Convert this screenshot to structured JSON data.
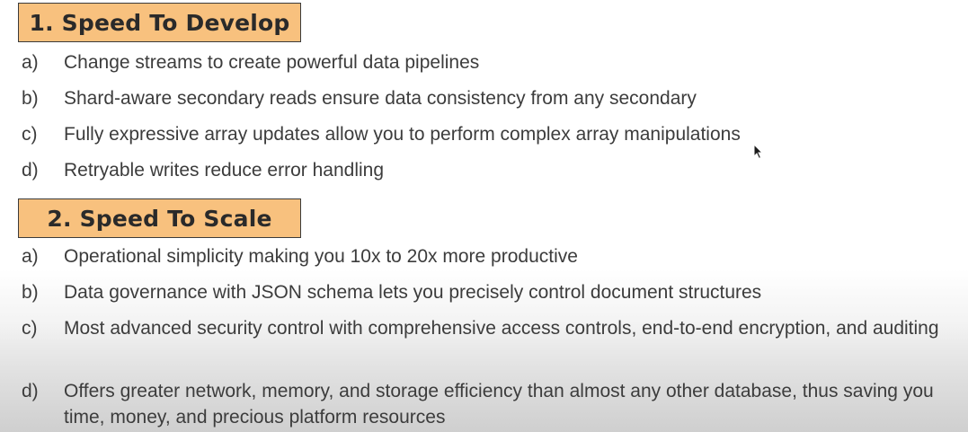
{
  "sections": [
    {
      "heading": "1. Speed To Develop",
      "items": [
        {
          "marker": "a)",
          "text": "Change streams to create powerful data pipelines"
        },
        {
          "marker": "b)",
          "text": "Shard-aware secondary reads ensure data consistency from any secondary"
        },
        {
          "marker": "c)",
          "text": "Fully expressive array updates allow you to perform complex array manipulations"
        },
        {
          "marker": "d)",
          "text": "Retryable writes reduce error handling"
        }
      ]
    },
    {
      "heading": "2. Speed To Scale",
      "items": [
        {
          "marker": "a)",
          "text": "Operational simplicity making you 10x to 20x more productive"
        },
        {
          "marker": "b)",
          "text": "Data governance with JSON schema lets you precisely control document structures"
        },
        {
          "marker": "c)",
          "text": "Most advanced security control with comprehensive access controls, end-to-end encryption, and auditing"
        },
        {
          "marker": "d)",
          "text": "Offers greater network, memory, and storage efficiency than almost any other database, thus saving you time, money, and precious platform resources"
        }
      ]
    }
  ],
  "colors": {
    "heading_fill": "#f8c17e",
    "heading_border": "#3b3b3b",
    "text": "#3c3c3c"
  },
  "icons": {
    "cursor": "mouse-pointer-icon"
  }
}
